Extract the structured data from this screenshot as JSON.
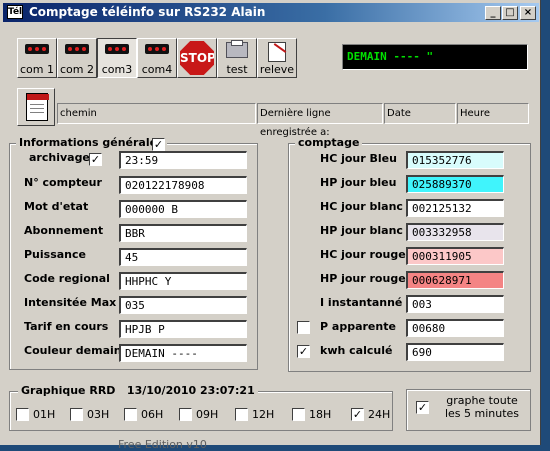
{
  "window": {
    "title": "Comptage téléinfo sur RS232 Alain",
    "icon_text": "Tél",
    "min": "_",
    "max": "□",
    "close": "×"
  },
  "toolbar": {
    "com1": "com 1",
    "com2": "com 2",
    "com3": "com3",
    "com4": "com4",
    "stop": "STOP",
    "test": "test",
    "releve": "releve",
    "display": "DEMAIN ---- \""
  },
  "infobar": {
    "chemin": "chemin",
    "last_line": "Dernière ligne enregistrée a:",
    "date": "Date",
    "heure": "Heure"
  },
  "general": {
    "title": "Informations générales",
    "checked_mark": "✓",
    "fields": {
      "archivage": {
        "label": "archivage",
        "value": "23:59"
      },
      "compteur": {
        "label": "N° compteur",
        "value": "020122178908"
      },
      "mot_etat": {
        "label": "Mot d'etat",
        "value": "000000 B"
      },
      "abonnement": {
        "label": "Abonnement",
        "value": "BBR"
      },
      "puissance": {
        "label": "Puissance",
        "value": "45"
      },
      "code_regional": {
        "label": "Code regional",
        "value": "HHPHC Y"
      },
      "intensite_max": {
        "label": "Intensitée Max",
        "value": "035"
      },
      "tarif": {
        "label": "Tarif en cours",
        "value": "HPJB P"
      },
      "couleur": {
        "label": "Couleur demain",
        "value": "DEMAIN ----"
      }
    }
  },
  "comptage": {
    "title": "comptage",
    "rows": {
      "hc_bleu": {
        "label": "HC jour Bleu",
        "value": "015352776",
        "color": "#d8fcfc"
      },
      "hp_bleu": {
        "label": "HP jour bleu",
        "value": "025889370",
        "color": "#40f4fc"
      },
      "hc_blanc": {
        "label": "HC jour blanc",
        "value": "002125132",
        "color": "#ffffff"
      },
      "hp_blanc": {
        "label": "HP jour blanc",
        "value": "003332958",
        "color": "#e8e4ec"
      },
      "hc_rouge": {
        "label": "HC jour rouge",
        "value": "000311905",
        "color": "#fcc8c8"
      },
      "hp_rouge": {
        "label": "HP jour rouge",
        "value": "000628971",
        "color": "#f48484"
      },
      "i_inst": {
        "label": "I instantanné",
        "value": "003",
        "color": "#ffffff"
      },
      "p_app": {
        "label": "P apparente",
        "value": "00680",
        "color": "#ffffff",
        "checked": false
      },
      "kwh": {
        "label": "kwh calculé",
        "value": "690",
        "color": "#ffffff",
        "checked": true
      }
    }
  },
  "graph": {
    "title": "Graphique RRD",
    "datetime": "13/10/2010 23:07:21",
    "options": [
      "01H",
      "03H",
      "06H",
      "09H",
      "12H",
      "18H",
      "24H"
    ],
    "checked": "24H",
    "every5_line1": "graphe toute",
    "every5_line2": "les 5 minutes",
    "every5_checked": true
  },
  "footer": {
    "partial": "Free Edition v10"
  }
}
